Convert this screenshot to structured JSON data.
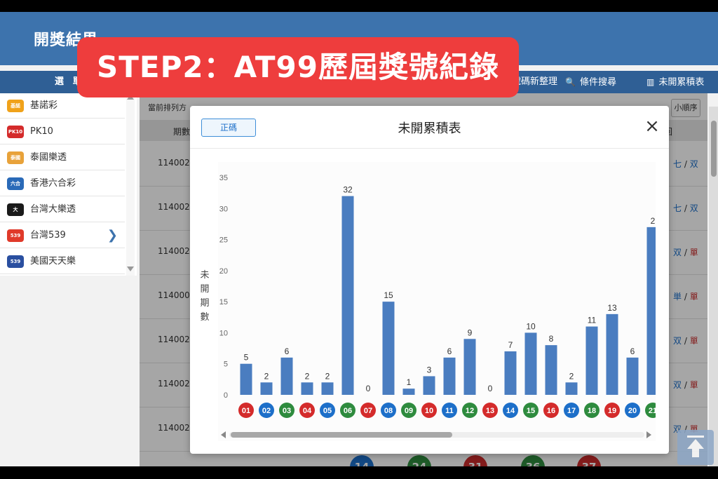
{
  "header": {
    "title": "開獎結果"
  },
  "banner": {
    "text": "STEP2：AT99歷屆獎號紀錄"
  },
  "nav": {
    "left_label": "選 單",
    "items": [
      {
        "label": "號碼新整理",
        "icon": "list-icon"
      },
      {
        "label": "條件搜尋",
        "icon": "search-icon"
      },
      {
        "label": "未開累積表",
        "icon": "bar-chart-icon"
      }
    ]
  },
  "sidebar": {
    "items": [
      {
        "label": "基諾彩",
        "logo_color": "#f0a21a",
        "logo_text": "基諾"
      },
      {
        "label": "PK10",
        "logo_color": "#d42b2b",
        "logo_text": "PK10"
      },
      {
        "label": "泰國樂透",
        "logo_color": "#e8a23a",
        "logo_text": "泰國"
      },
      {
        "label": "香港六合彩",
        "logo_color": "#2a6ab8",
        "logo_text": "六合"
      },
      {
        "label": "台灣大樂透",
        "logo_color": "#1a1a1a",
        "logo_text": "大"
      },
      {
        "label": "台灣539",
        "logo_color": "#e03a2a",
        "logo_text": "539"
      },
      {
        "label": "美國天天樂",
        "logo_color": "#2a4fa0",
        "logo_text": "539"
      }
    ],
    "active_index": 5
  },
  "table": {
    "sort_label": "當前排列方",
    "sort_button": "小順序",
    "col_period": "期數",
    "col_parity": "回",
    "rows": [
      {
        "period": "114002",
        "parity_a": "七",
        "parity_b": "双",
        "b_color": "ps"
      },
      {
        "period": "114002",
        "parity_a": "七",
        "parity_b": "双",
        "b_color": "ps"
      },
      {
        "period": "114002",
        "parity_a": "双",
        "parity_b": "單",
        "b_color": "pd"
      },
      {
        "period": "114000",
        "parity_a": "単",
        "parity_b": "單",
        "b_color": "pd"
      },
      {
        "period": "114002",
        "parity_a": "双",
        "parity_b": "單",
        "b_color": "pd"
      },
      {
        "period": "114002",
        "parity_a": "双",
        "parity_b": "單",
        "b_color": "pd"
      },
      {
        "period": "114002",
        "parity_a": "双",
        "parity_b": "單",
        "b_color": "pd"
      }
    ],
    "bottom_balls": [
      {
        "num": "14",
        "color": "#1d6fc9"
      },
      {
        "num": "24",
        "color": "#2e8b3e"
      },
      {
        "num": "31",
        "color": "#c92b2b"
      },
      {
        "num": "36",
        "color": "#2e8b3e"
      },
      {
        "num": "37",
        "color": "#c92b2b"
      }
    ]
  },
  "modal": {
    "title": "未開累積表",
    "sort_toggle": "正碼",
    "close": "×",
    "y_axis_label": "未開期數"
  },
  "chart_data": {
    "type": "bar",
    "title": "未開累積表",
    "ylabel": "未開期數",
    "ylim": [
      0,
      35
    ],
    "yticks": [
      0,
      5,
      10,
      15,
      20,
      25,
      30,
      35
    ],
    "grid": false,
    "categories": [
      "01",
      "02",
      "03",
      "04",
      "05",
      "06",
      "07",
      "08",
      "09",
      "10",
      "11",
      "12",
      "13",
      "14",
      "15",
      "16",
      "17",
      "18",
      "19",
      "20",
      "21"
    ],
    "values": [
      5,
      2,
      6,
      2,
      2,
      32,
      0,
      15,
      1,
      3,
      6,
      9,
      0,
      7,
      10,
      8,
      2,
      11,
      13,
      6,
      27
    ],
    "value_labels": [
      "5",
      "2",
      "6",
      "2",
      "2",
      "32",
      "0",
      "15",
      "1",
      "3",
      "6",
      "9",
      "0",
      "7",
      "10",
      "8",
      "2",
      "11",
      "13",
      "6",
      "2"
    ],
    "category_colors": [
      "#d42b2b",
      "#1d6fc9",
      "#2e8b3e",
      "#d42b2b",
      "#1d6fc9",
      "#2e8b3e",
      "#d42b2b",
      "#1d6fc9",
      "#2e8b3e",
      "#d42b2b",
      "#1d6fc9",
      "#2e8b3e",
      "#d42b2b",
      "#1d6fc9",
      "#2e8b3e",
      "#d42b2b",
      "#1d6fc9",
      "#2e8b3e",
      "#d42b2b",
      "#1d6fc9",
      "#2e8b3e"
    ],
    "bar_color": "#4a7dc0"
  }
}
